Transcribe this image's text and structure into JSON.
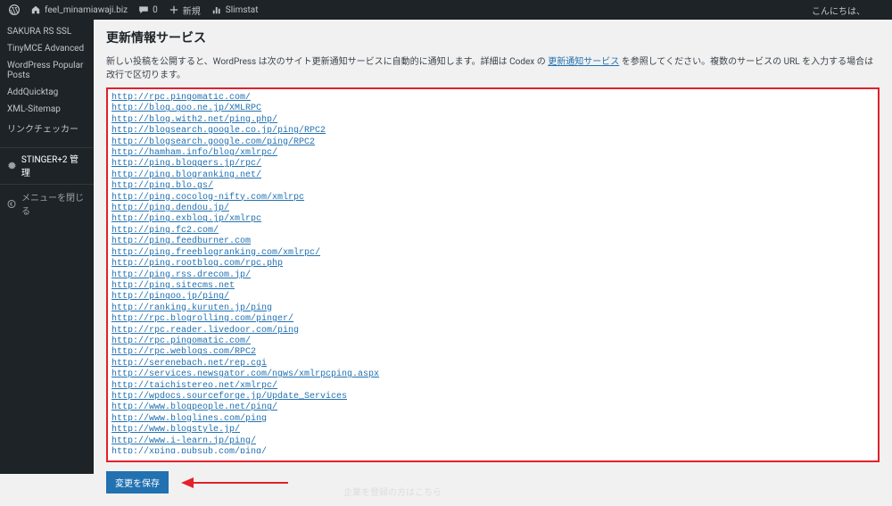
{
  "adminbar": {
    "site_name": "feel_minamiawaji.biz",
    "comments_count": "0",
    "new_label": "新規",
    "slimstat": "Slimstat",
    "greeting": "こんにちは、"
  },
  "sidebar": {
    "items": [
      "SAKURA RS SSL",
      "TinyMCE Advanced",
      "WordPress Popular Posts",
      "AddQuicktag",
      "XML-Sitemap",
      "リンクチェッカー"
    ],
    "stinger_label": "STINGER+2 管理",
    "collapse_label": "メニューを閉じる"
  },
  "page": {
    "title": "更新情報サービス",
    "desc_pre": "新しい投稿を公開すると、WordPress は次のサイト更新通知サービスに自動的に通知します。詳細は Codex の ",
    "desc_link": "更新通知サービス",
    "desc_post": " を参照してください。複数のサービスの URL を入力する場合は改行で区切ります。",
    "textarea_value": "http://rpc.pingomatic.com/\nhttp://blog.goo.ne.jp/XMLRPC\nhttp://blog.with2.net/ping.php/\nhttp://blogsearch.google.co.jp/ping/RPC2\nhttp://blogsearch.google.com/ping/RPC2\nhttp://hamham.info/blog/xmlrpc/\nhttp://ping.bloggers.jp/rpc/\nhttp://ping.blogranking.net/\nhttp://ping.blo.gs/\nhttp://ping.cocolog-nifty.com/xmlrpc\nhttp://ping.dendou.jp/\nhttp://ping.exblog.jp/xmlrpc\nhttp://ping.fc2.com/\nhttp://ping.feedburner.com\nhttp://ping.freeblogranking.com/xmlrpc/\nhttp://ping.rootblog.com/rpc.php\nhttp://ping.rss.drecom.jp/\nhttp://ping.sitecms.net\nhttp://pingoo.jp/ping/\nhttp://ranking.kuruten.jp/ping\nhttp://rpc.blogrolling.com/pinger/\nhttp://rpc.reader.livedoor.com/ping\nhttp://rpc.pingomatic.com/\nhttp://rpc.weblogs.com/RPC2\nhttp://serenebach.net/rep.cgi\nhttp://services.newsgator.com/ngws/xmlrpcping.aspx\nhttp://taichistereo.net/xmlrpc/\nhttp://wpdocs.sourceforge.jp/Update_Services\nhttp://www.blogpeople.net/ping/\nhttp://www.bloglines.com/ping\nhttp://www.blogstyle.jp/\nhttp://www.i-learn.jp/ping/\nhttp://xping.pubsub.com/ping/",
    "save_button": "変更を保存",
    "bottom_hint": "企業を登録の方はこちら"
  }
}
